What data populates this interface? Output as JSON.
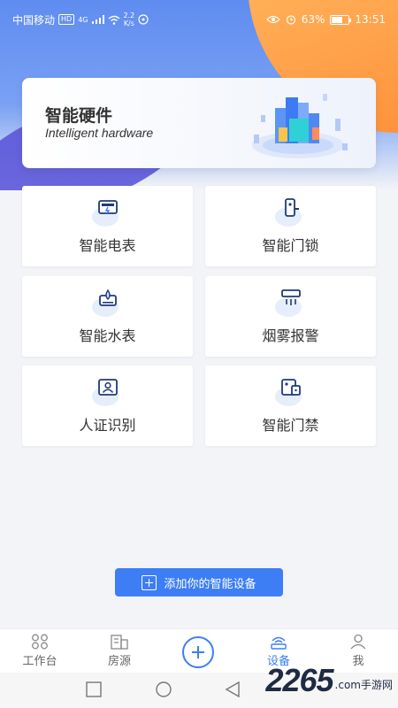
{
  "status_bar": {
    "carrier": "中国移动",
    "hd": "HD",
    "net": "4G",
    "speed_value": "2.2",
    "speed_unit": "K/s",
    "battery": "63%",
    "time": "13:51"
  },
  "hero": {
    "title": "智能硬件",
    "subtitle": "Intelligent hardware"
  },
  "devices": [
    {
      "label": "智能电表",
      "icon": "electric-meter-icon"
    },
    {
      "label": "智能门锁",
      "icon": "door-lock-icon"
    },
    {
      "label": "智能水表",
      "icon": "water-meter-icon"
    },
    {
      "label": "烟雾报警",
      "icon": "smoke-alarm-icon"
    },
    {
      "label": "人证识别",
      "icon": "id-recognition-icon"
    },
    {
      "label": "智能门禁",
      "icon": "access-control-icon"
    }
  ],
  "add_button": {
    "label": "添加你的智能设备"
  },
  "tabbar": {
    "tabs": [
      {
        "label": "工作台",
        "icon": "workbench-icon"
      },
      {
        "label": "房源",
        "icon": "listing-icon"
      },
      {
        "label": "设备",
        "icon": "device-icon"
      },
      {
        "label": "我",
        "icon": "user-icon"
      }
    ],
    "active": "设备",
    "active_color": "#3d7ef5"
  },
  "watermark": {
    "number": "2265",
    "text": ".com手游网"
  }
}
